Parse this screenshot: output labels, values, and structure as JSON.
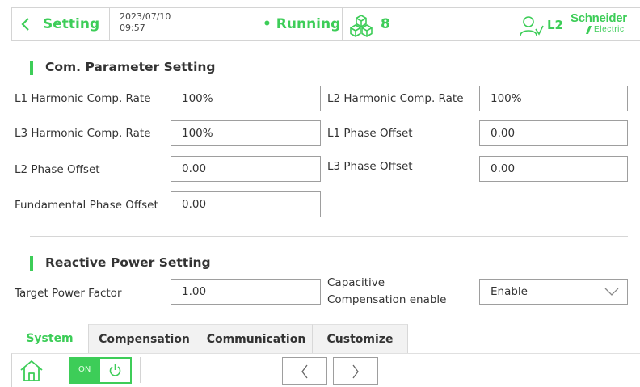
{
  "header": {
    "title": "Setting",
    "date": "2023/07/10",
    "time": "09:57",
    "status": "• Running",
    "device_count": "8",
    "user_level": "L2",
    "brand_top": "Schneider",
    "brand_bottom": "Electric"
  },
  "sections": {
    "com": {
      "title": "Com. Parameter Setting",
      "l1_harm_label": "L1 Harmonic Comp. Rate",
      "l1_harm_value": "100%",
      "l2_harm_label": "L2 Harmonic Comp. Rate",
      "l2_harm_value": "100%",
      "l3_harm_label": "L3 Harmonic Comp. Rate",
      "l3_harm_value": "100%",
      "l1_phase_label": "L1 Phase Offset",
      "l1_phase_value": "0.00",
      "l2_phase_label": "L2 Phase Offset",
      "l2_phase_value": "0.00",
      "l3_phase_label": "L3 Phase Offset",
      "l3_phase_value": "0.00",
      "fund_phase_label": "Fundamental Phase Offset",
      "fund_phase_value": "0.00"
    },
    "reactive": {
      "title": "Reactive Power Setting",
      "target_pf_label": "Target Power Factor",
      "target_pf_value": "1.00",
      "cap_comp_label_1": "Capacitive",
      "cap_comp_label_2": "Compensation enable",
      "cap_comp_value": "Enable"
    }
  },
  "tabs": [
    "System",
    "Compensation",
    "Communication",
    "Customize"
  ],
  "bottom": {
    "toggle_label": "ON"
  },
  "colors": {
    "accent": "#3dcd58"
  }
}
